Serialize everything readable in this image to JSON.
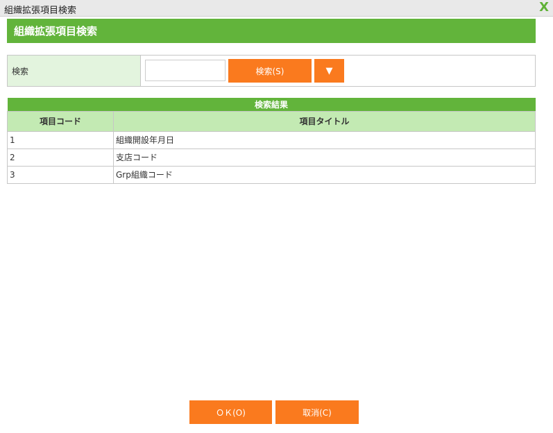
{
  "window": {
    "title": "組織拡張項目検索",
    "close": "X"
  },
  "header": {
    "title": "組織拡張項目検索"
  },
  "search": {
    "label": "検索",
    "value": "",
    "button": "検索(S)",
    "dropdown": "▼"
  },
  "results": {
    "caption": "検索結果",
    "columns": [
      "項目コード",
      "項目タイトル"
    ],
    "rows": [
      {
        "code": "1",
        "title": "組織開設年月日"
      },
      {
        "code": "2",
        "title": "支店コード"
      },
      {
        "code": "3",
        "title": "Grp組織コード"
      }
    ]
  },
  "footer": {
    "ok": "ＯＫ(O)",
    "cancel": "取消(C)"
  }
}
